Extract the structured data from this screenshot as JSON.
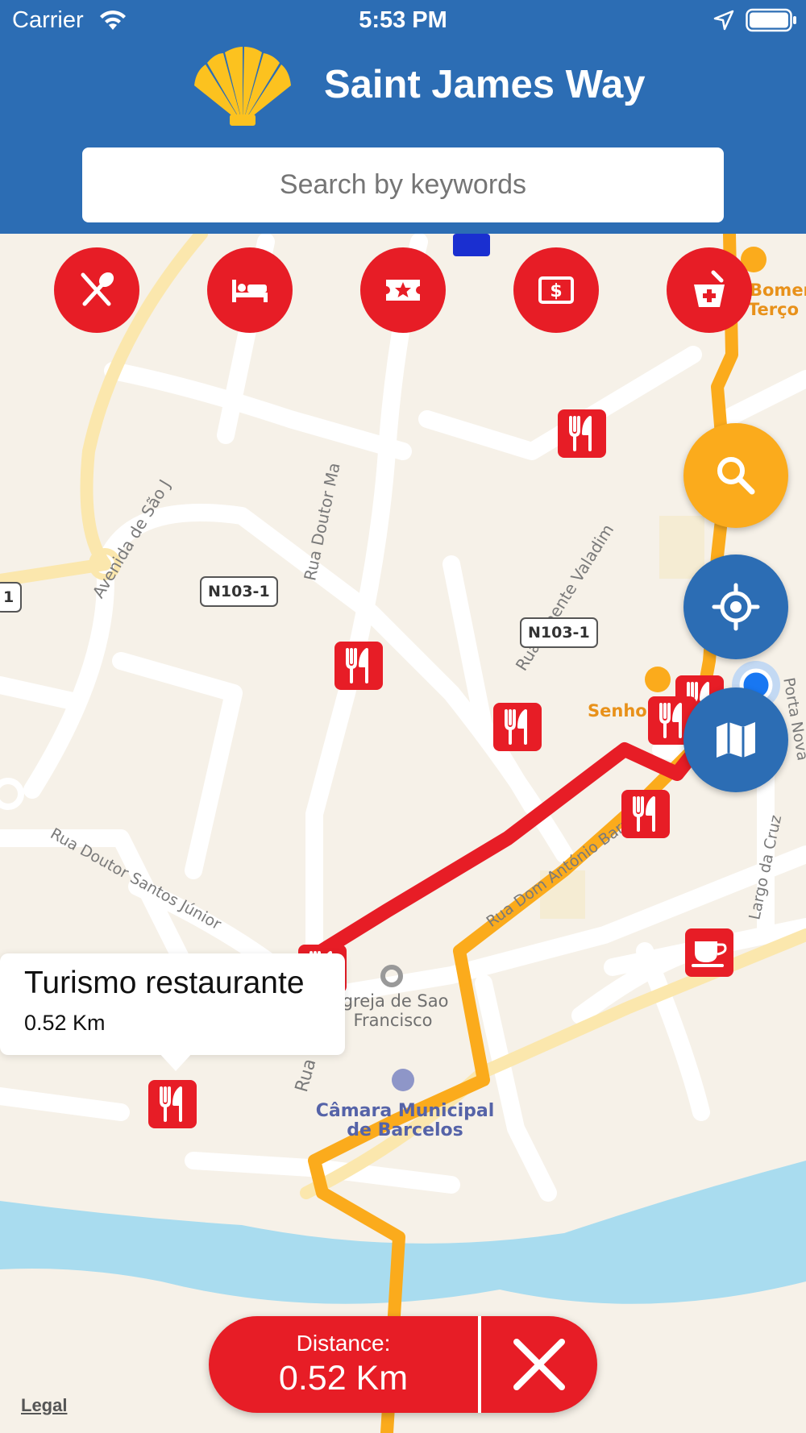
{
  "status_bar": {
    "carrier": "Carrier",
    "time": "5:53 PM"
  },
  "header": {
    "title": "Saint James Way"
  },
  "search": {
    "placeholder": "Search by keywords"
  },
  "categories": [
    {
      "name": "restaurants",
      "icon": "fork-spoon-icon"
    },
    {
      "name": "lodging",
      "icon": "bed-icon"
    },
    {
      "name": "attractions",
      "icon": "ticket-star-icon"
    },
    {
      "name": "atm",
      "icon": "money-icon"
    },
    {
      "name": "pharmacy",
      "icon": "pharmacy-icon"
    }
  ],
  "map": {
    "street_labels": {
      "avenida": "Avenida de São J",
      "doutor_ma": "Rua Doutor Ma",
      "tenente": "Rua Tenente Valadim",
      "barreta": "Rua da Barreta",
      "santos": "Rua Doutor Santos Júnior",
      "antonio": "Rua Dom António Barroso",
      "largo": "Largo da Cruz",
      "porta": "Porta Nova"
    },
    "road_signs": {
      "sign_left": "N103-1",
      "sign_right": "N103-1",
      "sign_edge": "1"
    },
    "places": {
      "igreja": "Igreja de Sao Francisco",
      "camara": "Câmara Municipal de Barcelos",
      "senho": "Senho",
      "bomerc": "Bomerc",
      "terco": "Terço"
    }
  },
  "callout": {
    "title": "Turismo restaurante",
    "distance": "0.52 Km"
  },
  "distance_bar": {
    "label": "Distance:",
    "value": "0.52 Km"
  },
  "legal": "Legal",
  "colors": {
    "header": "#2c6db4",
    "accent_red": "#e71d26",
    "route_orange": "#fbab1c",
    "water": "#a9dcef"
  }
}
